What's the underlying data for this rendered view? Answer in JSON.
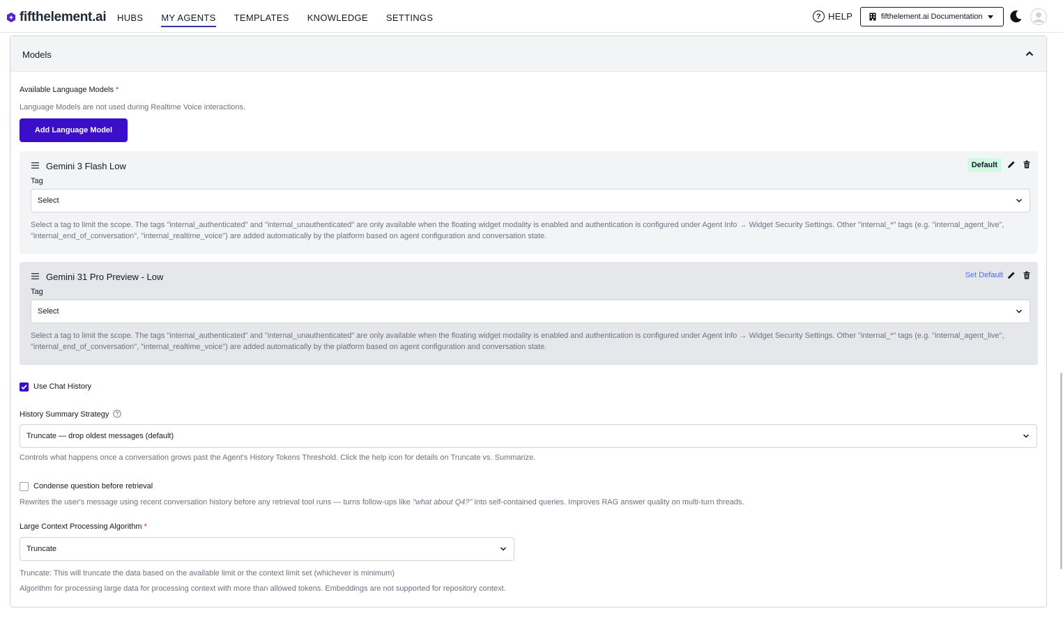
{
  "brand": {
    "name": "fifthelement.ai",
    "accent": "#3b0fc9"
  },
  "nav": {
    "items": [
      {
        "label": "HUBS"
      },
      {
        "label": "MY AGENTS"
      },
      {
        "label": "TEMPLATES"
      },
      {
        "label": "KNOWLEDGE"
      },
      {
        "label": "SETTINGS"
      }
    ],
    "active": "MY AGENTS"
  },
  "header_right": {
    "help_label": "HELP",
    "docs_label": "fifthelement.ai Documentation"
  },
  "panel": {
    "title": "Models",
    "available_models_label": "Available Language Models",
    "required_mark": "*",
    "available_models_help": "Language Models are not used during Realtime Voice interactions.",
    "add_button_label": "Add Language Model",
    "models": [
      {
        "name": "Gemini 3 Flash Low",
        "status": "Default",
        "tag_label": "Tag",
        "tag_value": "Select",
        "tag_help": "Select a tag to limit the scope. The tags \"internal_authenticated\" and \"internal_unauthenticated\" are only available when the floating widget modality is enabled and authentication is configured under Agent Info → Widget Security Settings. Other \"internal_*\" tags (e.g. \"internal_agent_live\", \"internal_end_of_conversation\", \"internal_realtime_voice\") are added automatically by the platform based on agent configuration and conversation state."
      },
      {
        "name": "Gemini 31 Pro Preview - Low",
        "status": "Set Default",
        "tag_label": "Tag",
        "tag_value": "Select",
        "tag_help": "Select a tag to limit the scope. The tags \"internal_authenticated\" and \"internal_unauthenticated\" are only available when the floating widget modality is enabled and authentication is configured under Agent Info → Widget Security Settings. Other \"internal_*\" tags (e.g. \"internal_agent_live\", \"internal_end_of_conversation\", \"internal_realtime_voice\") are added automatically by the platform based on agent configuration and conversation state."
      }
    ],
    "use_chat_history": {
      "label": "Use Chat History",
      "checked": true
    },
    "history_summary": {
      "label": "History Summary Strategy",
      "value": "Truncate — drop oldest messages (default)",
      "help": "Controls what happens once a conversation grows past the Agent's History Tokens Threshold. Click the help icon for details on Truncate vs. Summarize."
    },
    "condense": {
      "label": "Condense question before retrieval",
      "checked": false,
      "help_prefix": "Rewrites the user's message using recent conversation history before any retrieval tool runs — turns follow-ups like ",
      "help_quote": "\"what about Q4?\"",
      "help_suffix": " into self-contained queries. Improves RAG answer quality on multi-turn threads."
    },
    "large_context": {
      "label": "Large Context Processing Algorithm",
      "value": "Truncate",
      "help_1": "Truncate: This will truncate the data based on the available limit or the context limit set (whichever is minimum)",
      "help_2": "Algorithm for processing large data for processing context with more than allowed tokens. Embeddings are not supported for repository context."
    }
  }
}
